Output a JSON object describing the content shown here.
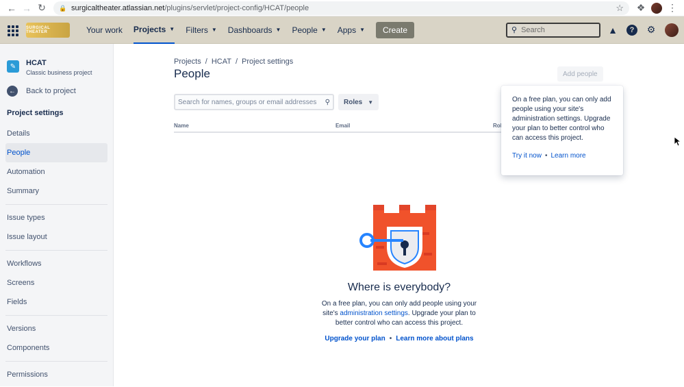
{
  "browser": {
    "url_host": "surgicaltheater.atlassian.net",
    "url_path": "/plugins/servlet/project-config/HCAT/people"
  },
  "topnav": {
    "logo_text": "SURGICAL THEATER",
    "items": [
      {
        "label": "Your work"
      },
      {
        "label": "Projects"
      },
      {
        "label": "Filters"
      },
      {
        "label": "Dashboards"
      },
      {
        "label": "People"
      },
      {
        "label": "Apps"
      }
    ],
    "create_label": "Create",
    "search_placeholder": "Search",
    "help_glyph": "?"
  },
  "sidebar": {
    "project_name": "HCAT",
    "project_type": "Classic business project",
    "back_label": "Back to project",
    "section_title": "Project settings",
    "groups": [
      [
        "Details",
        "People",
        "Automation",
        "Summary"
      ],
      [
        "Issue types",
        "Issue layout"
      ],
      [
        "Workflows",
        "Screens",
        "Fields"
      ],
      [
        "Versions",
        "Components"
      ],
      [
        "Permissions"
      ]
    ],
    "active_item": "People"
  },
  "content": {
    "breadcrumbs": [
      "Projects",
      "HCAT",
      "Project settings"
    ],
    "breadcrumb_sep": "/",
    "title": "People",
    "add_people_label": "Add people",
    "search_placeholder": "Search for names, groups or email addresses",
    "roles_label": "Roles",
    "columns": [
      "Name",
      "Email",
      "Rol"
    ]
  },
  "popup": {
    "text": "On a free plan, you can only add people using your site's administration settings. Upgrade your plan to better control who can access this project.",
    "link_try": "Try it now",
    "link_learn": "Learn more",
    "separator": "•"
  },
  "empty_state": {
    "heading": "Where is everybody?",
    "body_before": "On a free plan, you can only add people using your site's ",
    "body_link": "administration settings",
    "body_after": ". Upgrade your plan to better control who can access this project.",
    "link_upgrade": "Upgrade your plan",
    "link_learn_plans": "Learn more about plans",
    "separator": "•"
  },
  "colors": {
    "nav_bg": "#d9d4c6",
    "accent": "#0052cc",
    "castle": "#f0522b",
    "key_blue": "#2684ff"
  }
}
